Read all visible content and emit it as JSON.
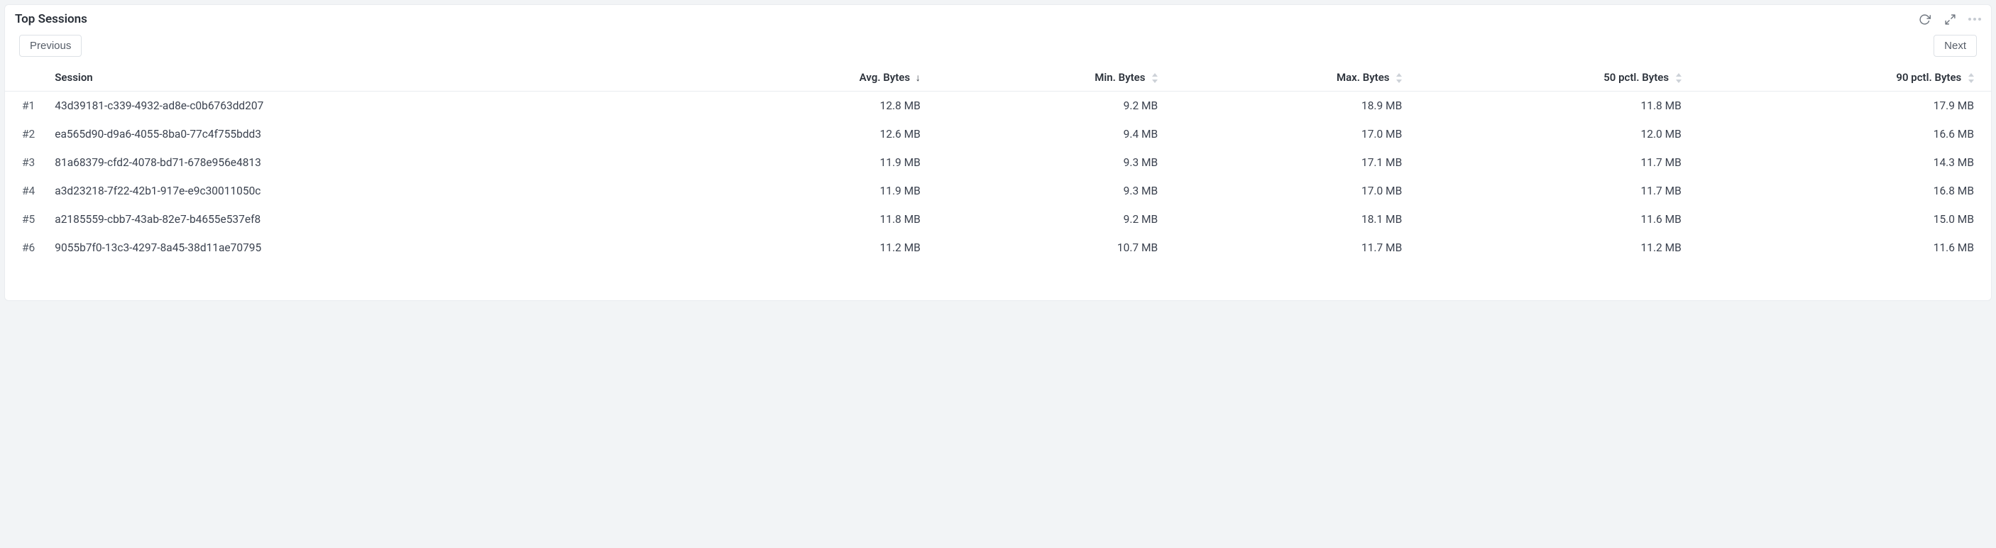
{
  "panel": {
    "title": "Top Sessions"
  },
  "pager": {
    "previous_label": "Previous",
    "next_label": "Next"
  },
  "columns": {
    "session": "Session",
    "avg": "Avg. Bytes",
    "min": "Min. Bytes",
    "max": "Max. Bytes",
    "p50": "50 pctl. Bytes",
    "p90": "90 pctl. Bytes"
  },
  "rows": [
    {
      "rank": "#1",
      "session": "43d39181-c339-4932-ad8e-c0b6763dd207",
      "avg": "12.8 MB",
      "min": "9.2 MB",
      "max": "18.9 MB",
      "p50": "11.8 MB",
      "p90": "17.9 MB"
    },
    {
      "rank": "#2",
      "session": "ea565d90-d9a6-4055-8ba0-77c4f755bdd3",
      "avg": "12.6 MB",
      "min": "9.4 MB",
      "max": "17.0 MB",
      "p50": "12.0 MB",
      "p90": "16.6 MB"
    },
    {
      "rank": "#3",
      "session": "81a68379-cfd2-4078-bd71-678e956e4813",
      "avg": "11.9 MB",
      "min": "9.3 MB",
      "max": "17.1 MB",
      "p50": "11.7 MB",
      "p90": "14.3 MB"
    },
    {
      "rank": "#4",
      "session": "a3d23218-7f22-42b1-917e-e9c30011050c",
      "avg": "11.9 MB",
      "min": "9.3 MB",
      "max": "17.0 MB",
      "p50": "11.7 MB",
      "p90": "16.8 MB"
    },
    {
      "rank": "#5",
      "session": "a2185559-cbb7-43ab-82e7-b4655e537ef8",
      "avg": "11.8 MB",
      "min": "9.2 MB",
      "max": "18.1 MB",
      "p50": "11.6 MB",
      "p90": "15.0 MB"
    },
    {
      "rank": "#6",
      "session": "9055b7f0-13c3-4297-8a45-38d11ae70795",
      "avg": "11.2 MB",
      "min": "10.7 MB",
      "max": "11.7 MB",
      "p50": "11.2 MB",
      "p90": "11.6 MB"
    }
  ]
}
